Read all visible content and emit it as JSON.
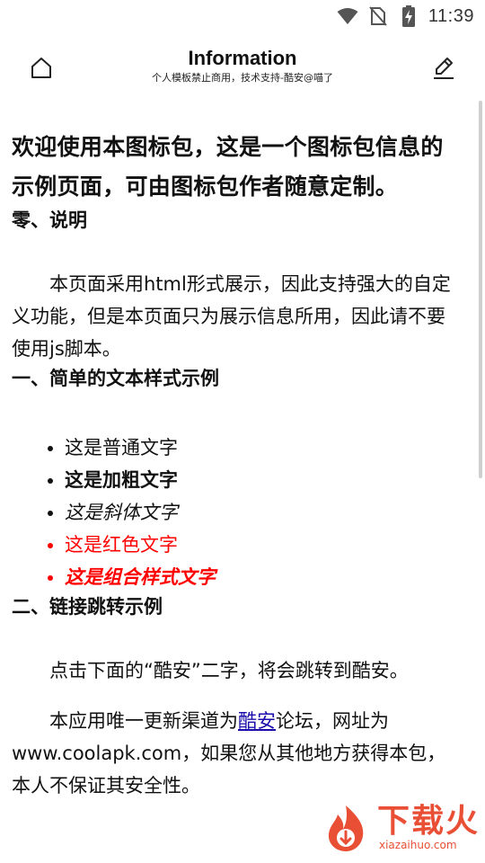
{
  "status_bar": {
    "time": "11:39",
    "icons": [
      "wifi-icon",
      "no-sim-icon",
      "battery-charging-icon"
    ]
  },
  "toolbar": {
    "title": "Information",
    "subtitle": "个人模板禁止商用，技术支持-酷安@喵了",
    "home_icon": "home-icon",
    "edit_icon": "edit-pencil-icon"
  },
  "content": {
    "intro": "欢迎使用本图标包，这是一个图标包信息的示例页面，可由图标包作者随意定制。",
    "section0_title": "零、说明",
    "section0_text": "本页面采用html形式展示，因此支持强大的自定义功能，但是本页面只为展示信息所用，因此请不要使用js脚本。",
    "section1_title": "一、简单的文本样式示例",
    "samples": {
      "normal": "这是普通文字",
      "bold": "这是加粗文字",
      "italic": "这是斜体文字",
      "red": "这是红色文字",
      "combo": "这是组合样式文字"
    },
    "section2_title": "二、链接跳转示例",
    "section2_text": "点击下面的“酷安”二字，将会跳转到酷安。",
    "section2_text2_before": "本应用唯一更新渠道为",
    "section2_link": "酷安",
    "section2_text2_after": "论坛，网址为www.coolapk.com，如果您从其他地方获得本包，本人不保证其安全性。"
  },
  "watermark": {
    "title": "下载火",
    "domain": "xiazaihuo.com",
    "color": "#e8462b"
  },
  "colors": {
    "red_text": "#ff0000",
    "link": "#1a0dab"
  }
}
